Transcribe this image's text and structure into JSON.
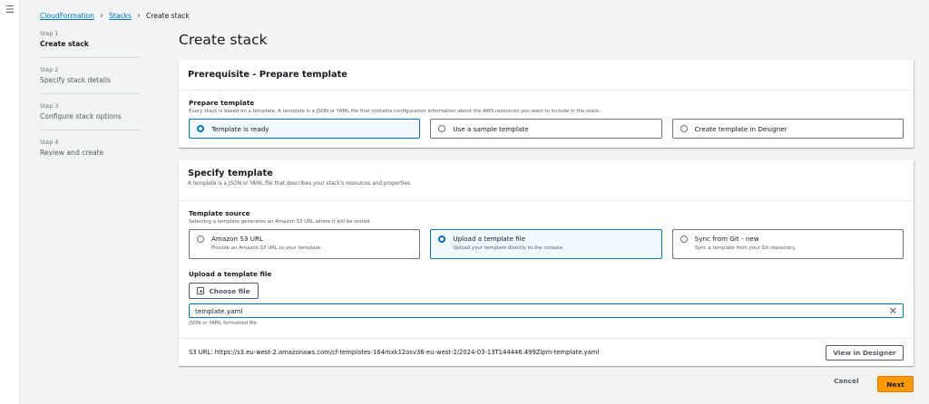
{
  "nav": {
    "menu_icon": "hamburger-icon"
  },
  "breadcrumb": {
    "items": [
      "CloudFormation",
      "Stacks"
    ],
    "current": "Create stack"
  },
  "steps": [
    {
      "num": "Step 1",
      "label": "Create stack",
      "active": true
    },
    {
      "num": "Step 2",
      "label": "Specify stack details"
    },
    {
      "num": "Step 3",
      "label": "Configure stack options"
    },
    {
      "num": "Step 4",
      "label": "Review and create"
    }
  ],
  "page_title": "Create stack",
  "prereq": {
    "title": "Prerequisite - Prepare template",
    "field_label": "Prepare template",
    "field_desc": "Every stack is based on a template. A template is a JSON or YAML file that contains configuration information about the AWS resources you want to include in the stack.",
    "options": [
      "Template is ready",
      "Use a sample template",
      "Create template in Designer"
    ]
  },
  "specify": {
    "title": "Specify template",
    "desc": "A template is a JSON or YAML file that describes your stack's resources and properties.",
    "source_label": "Template source",
    "source_desc": "Selecting a template generates an Amazon S3 URL where it will be stored.",
    "options": [
      {
        "label": "Amazon S3 URL",
        "desc": "Provide an Amazon S3 URL to your template."
      },
      {
        "label": "Upload a template file",
        "desc": "Upload your template directly to the console."
      },
      {
        "label": "Sync from Git - new",
        "desc": "Sync a template from your Git repository."
      }
    ],
    "upload_label": "Upload a template file",
    "choose_file": "Choose file",
    "file_name": "template.yaml",
    "file_hint": "JSON or YAML formatted file",
    "s3_url": "S3 URL:  https://s3.eu-west-2.amazonaws.com/cf-templates-164mxk12osv36-eu-west-2/2024-03-13T144446.499Zipm-template.yaml",
    "view_designer": "View in Designer"
  },
  "footer": {
    "cancel": "Cancel",
    "next": "Next"
  },
  "colors": {
    "accent": "#0073bb",
    "primary_button": "#ff9900"
  }
}
